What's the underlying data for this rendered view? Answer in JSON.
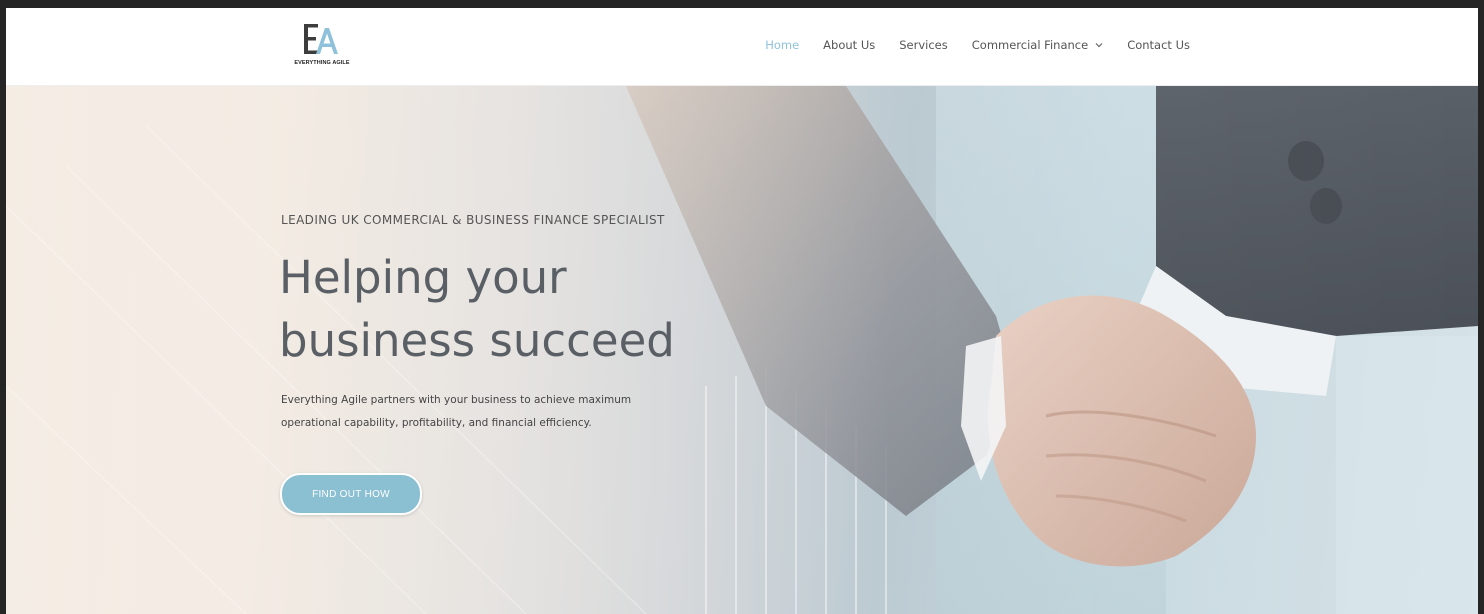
{
  "brand": {
    "logo_mark_e": "E",
    "logo_mark_a": "A",
    "logo_text": "EVERYTHING AGILE"
  },
  "nav": {
    "items": [
      {
        "label": "Home",
        "active": true
      },
      {
        "label": "About Us",
        "active": false
      },
      {
        "label": "Services",
        "active": false
      },
      {
        "label": "Commercial Finance",
        "active": false,
        "has_dropdown": true
      },
      {
        "label": "Contact Us",
        "active": false
      }
    ]
  },
  "hero": {
    "eyebrow": "LEADING UK COMMERCIAL & BUSINESS FINANCE SPECIALIST",
    "headline_line1": "Helping your",
    "headline_line2": "business succeed",
    "subtext_line1": "Everything Agile partners with your business to achieve maximum",
    "subtext_line2": "operational capability, profitability, and financial efficiency.",
    "cta_label": "FIND OUT HOW"
  },
  "colors": {
    "accent": "#8fc2da",
    "cta_bg": "#8bbfd2",
    "text_dark": "#5a5f66",
    "frame_bg": "#252525"
  },
  "icons": {
    "dropdown": "chevron-down-icon",
    "hero_image": "handshake-image"
  }
}
